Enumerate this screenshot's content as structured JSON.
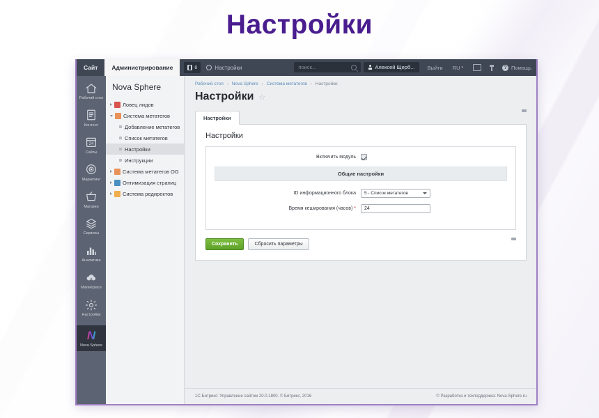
{
  "hero": {
    "title": "Настройки"
  },
  "topbar": {
    "site_tab": "Сайт",
    "admin_tab": "Администрирование",
    "badge_count": "6",
    "settings_label": "Настройки",
    "settings_icon": "gear-icon",
    "search_placeholder": "поиск...",
    "search_icon": "search-icon",
    "user_name": "Алексей Щерб...",
    "user_icon": "person-icon",
    "logout_label": "Выйти",
    "lang_label": "RU",
    "window_icon": "window-icon",
    "pin_icon": "pin-icon",
    "help_label": "Помощь",
    "help_icon": "help-circle-icon"
  },
  "icon_sidebar": {
    "items": [
      {
        "label": "Рабочий стол",
        "icon": "home-icon",
        "selected": false
      },
      {
        "label": "Контент",
        "icon": "document-icon",
        "selected": false
      },
      {
        "label": "Сайты",
        "icon": "calendar-24-icon",
        "selected": false
      },
      {
        "label": "Маркетинг",
        "icon": "target-icon",
        "selected": false
      },
      {
        "label": "Магазин",
        "icon": "basket-icon",
        "selected": false
      },
      {
        "label": "Сервисы",
        "icon": "layers-icon",
        "selected": false
      },
      {
        "label": "Аналитика",
        "icon": "bar-chart-icon",
        "selected": false
      },
      {
        "label": "Marketplace",
        "icon": "cloud-download-icon",
        "selected": false
      },
      {
        "label": "Настройки",
        "icon": "gear-icon",
        "selected": false
      },
      {
        "label": "Nova Sphere",
        "icon": "nova-n-icon",
        "selected": true
      }
    ]
  },
  "tree": {
    "title": "Nova Sphere",
    "items": [
      {
        "label": "Ловец лидов",
        "level": 0,
        "arrow": "closed",
        "icon_color": "#d9534f",
        "selected": false
      },
      {
        "label": "Система метатегов",
        "level": 0,
        "arrow": "open",
        "icon_color": "#e8925a",
        "selected": false
      },
      {
        "label": "Добавление метатегов",
        "level": 1,
        "arrow": "none",
        "icon_color": "",
        "selected": false
      },
      {
        "label": "Список метатегов",
        "level": 1,
        "arrow": "none",
        "icon_color": "",
        "selected": false
      },
      {
        "label": "Настройки",
        "level": 1,
        "arrow": "none",
        "icon_color": "",
        "selected": true
      },
      {
        "label": "Инструкции",
        "level": 1,
        "arrow": "none",
        "icon_color": "",
        "selected": false
      },
      {
        "label": "Система метатегов OG",
        "level": 0,
        "arrow": "closed",
        "icon_color": "#e8925a",
        "selected": false
      },
      {
        "label": "Оптимизация страниц",
        "level": 0,
        "arrow": "closed",
        "icon_color": "#4a90c2",
        "selected": false
      },
      {
        "label": "Система редиректов",
        "level": 0,
        "arrow": "closed",
        "icon_color": "#f0ad4e",
        "selected": false
      }
    ]
  },
  "breadcrumb": {
    "items": [
      "Рабочий стол",
      "Nova Sphere",
      "Система метатегов",
      "Настройки"
    ],
    "separator": "›"
  },
  "page": {
    "title": "Настройки",
    "star_icon": "star-icon",
    "pin_icon": "pin-icon"
  },
  "tabs": [
    {
      "label": "Настройки",
      "active": true
    }
  ],
  "panel": {
    "title": "Настройки",
    "enable_module_label": "Включить модуль",
    "enable_module_checked": true,
    "section_header": "Общие настройки",
    "fields": [
      {
        "label": "ID информационного блока",
        "type": "select",
        "value": "5 - Список метатегов",
        "required": false
      },
      {
        "label": "Время кеширования (часов)",
        "type": "text",
        "value": "24",
        "required": true
      }
    ],
    "save_label": "Сохранить",
    "reset_label": "Сбросить параметры"
  },
  "footer": {
    "left": "1С-Битрикс: Управление сайтом 20.0.1800. © Битрикс, 2016",
    "right": "© Разработка и техподдержка: Nova-Sphere.ru"
  },
  "colors": {
    "hero_purple": "#4a1d8f",
    "topbar_dark": "#3f4654",
    "icon_sidebar": "#5c6372",
    "save_green": "#5fa22b",
    "window_border": "#9f7fc4"
  }
}
